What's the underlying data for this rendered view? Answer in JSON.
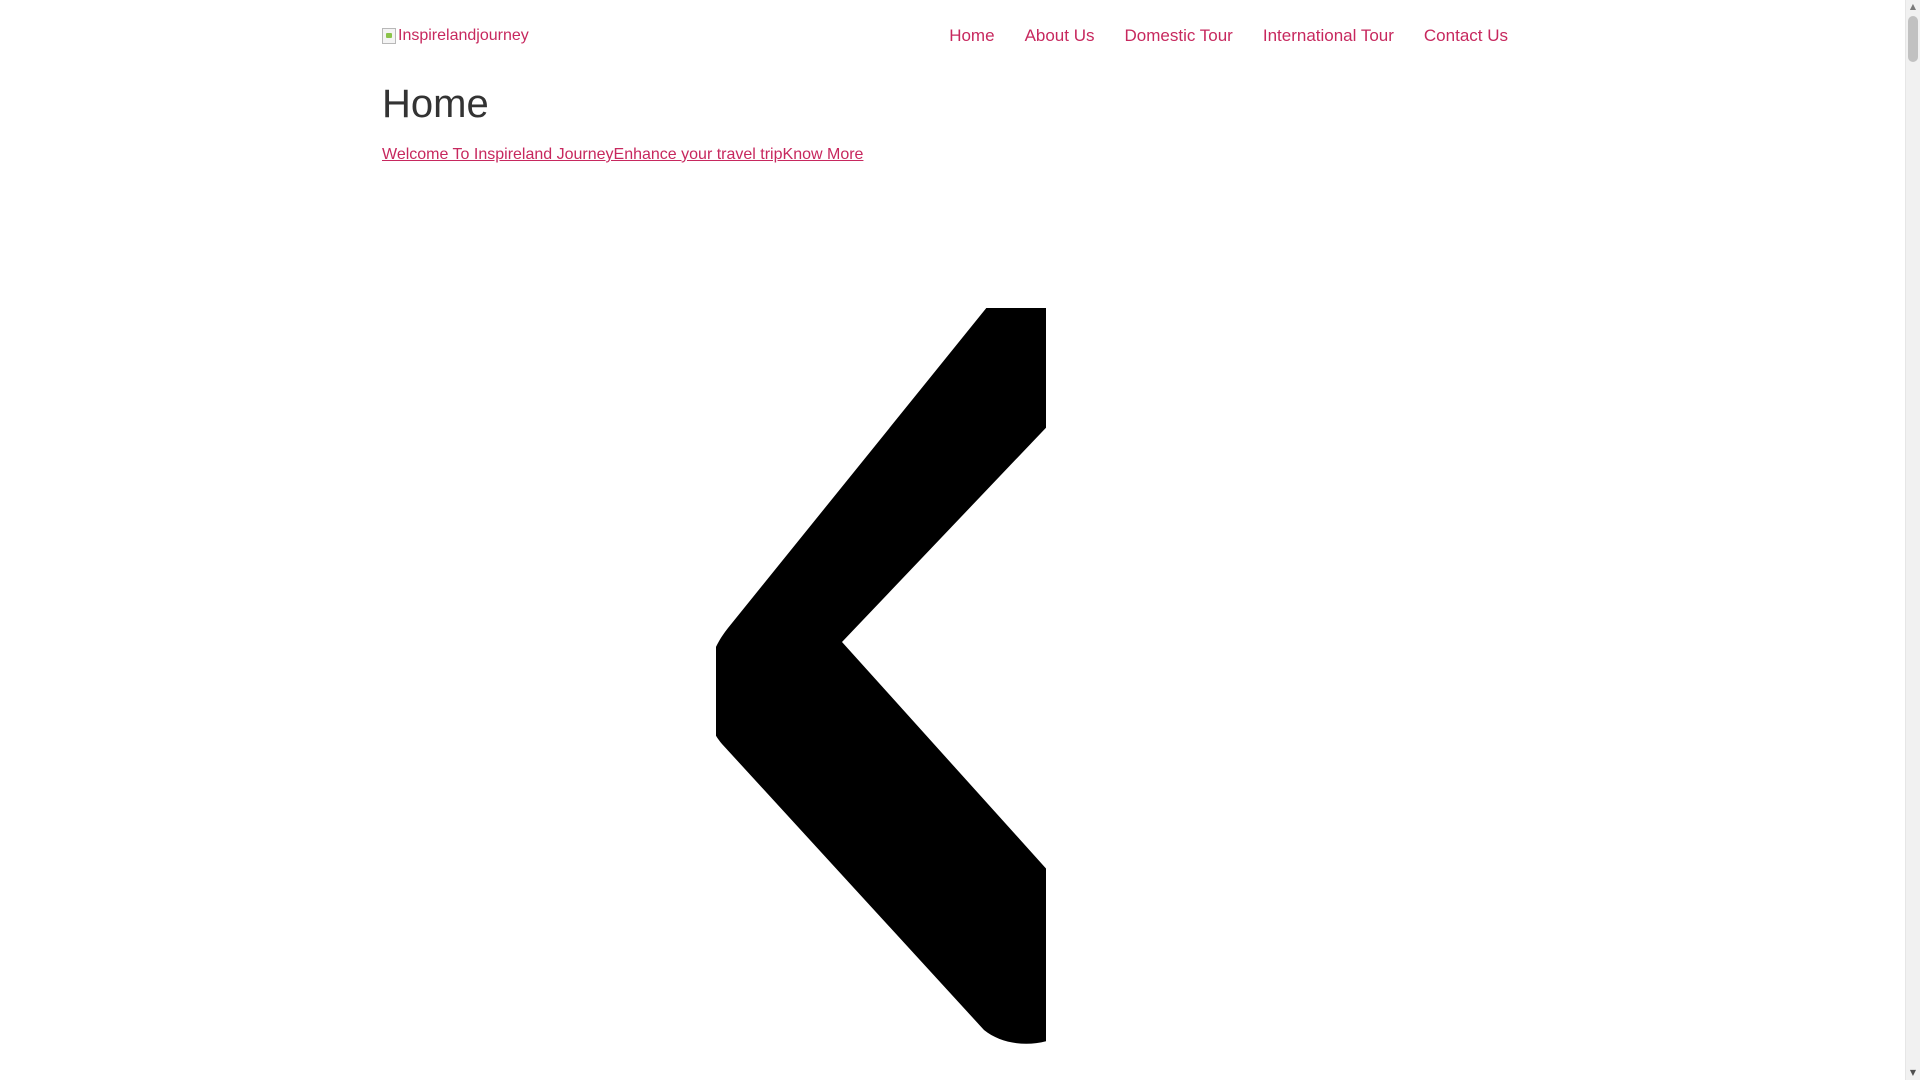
{
  "header": {
    "logo_alt": "Inspirelandjourney",
    "nav": [
      {
        "label": "Home"
      },
      {
        "label": "About Us"
      },
      {
        "label": "Domestic Tour"
      },
      {
        "label": "International Tour"
      },
      {
        "label": "Contact Us"
      }
    ]
  },
  "main": {
    "title": "Home",
    "links": [
      {
        "label": "Welcome To Inspireland Journey"
      },
      {
        "label": "Enhance your travel trip"
      },
      {
        "label": "Know More"
      }
    ],
    "slider_prev_icon": "chevron-left-icon"
  },
  "scrollbar": {
    "up_arrow": "▲",
    "down_arrow": "▼"
  },
  "colors": {
    "accent": "#c7285e",
    "heading": "#333333",
    "background": "#ffffff",
    "icon": "#000000"
  }
}
